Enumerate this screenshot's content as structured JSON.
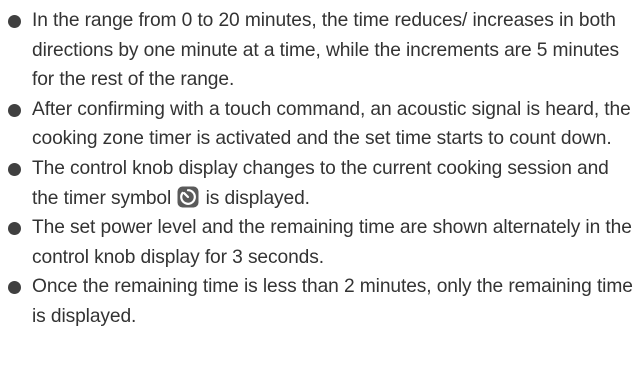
{
  "bullets": [
    {
      "text": "In the range from 0 to 20 minutes, the time reduces/ increases in both directions by one minute at a time, while the increments are 5 minutes for the rest of the range."
    },
    {
      "text": "After confirming with a touch command, an acoustic signal is heard, the cooking zone timer is activated and the set time starts to count down."
    },
    {
      "text_before": "The control knob display changes to the current cooking session and the timer symbol",
      "icon": "timer-icon",
      "text_after": "is displayed."
    },
    {
      "text": "The set power level and the remaining time are shown alternately in the control knob display for 3 seconds."
    },
    {
      "text": "Once the remaining time is less than 2 minutes, only the remaining time is displayed."
    }
  ]
}
